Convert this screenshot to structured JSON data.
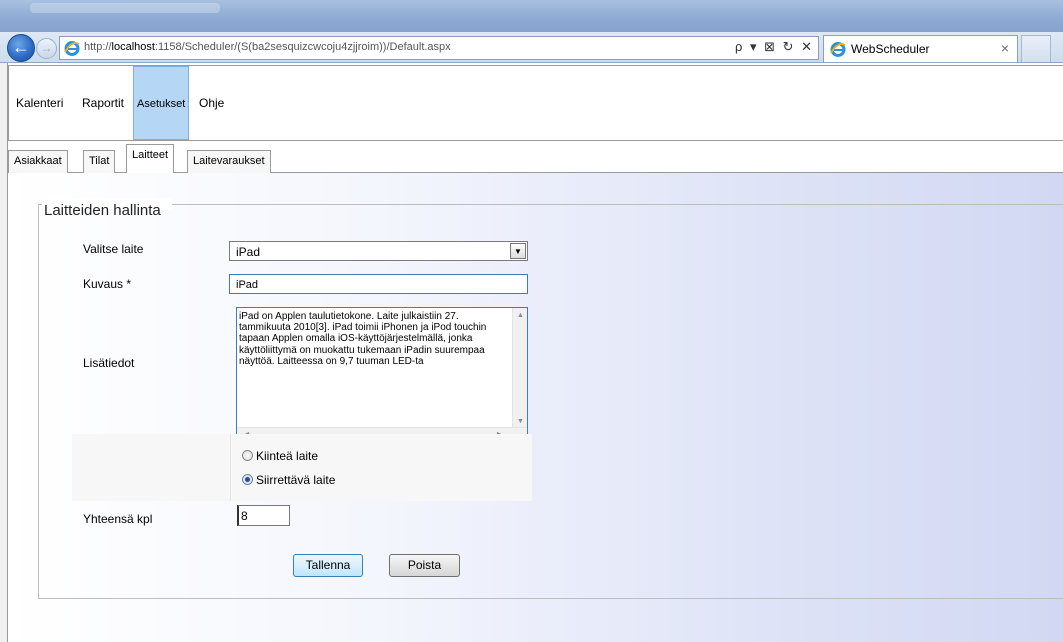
{
  "browser": {
    "url_prefix": "http://",
    "url_host": "localhost",
    "url_rest": ":1158/Scheduler/(S(ba2sesquizcwcoju4zjjroim))/Default.aspx",
    "address_tools": "ρ ▾ ⊠ ↻ ✕",
    "tab_title": "WebScheduler",
    "tab_close": "×"
  },
  "menu": {
    "items": [
      "Kalenteri",
      "Raportit",
      "Asetukset",
      "Ohje"
    ],
    "active": "Asetukset"
  },
  "tabs": {
    "items": [
      "Asiakkaat",
      "Tilat",
      "Laitteet",
      "Laitevaraukset"
    ],
    "active": "Laitteet"
  },
  "form": {
    "legend": "Laitteiden hallinta",
    "device_label": "Valitse laite",
    "device_value": "iPad",
    "description_label": "Kuvaus *",
    "description_value": "iPad",
    "info_label": "Lisätiedot",
    "info_value": "iPad on Applen taulutietokone. Laite julkaistiin 27. tammikuuta 2010[3]. iPad toimii iPhonen ja iPod touchin tapaan Applen omalla iOS-käyttöjärjestelmällä, jonka käyttöliittymä on muokattu tukemaan iPadin suurempaa näyttöä. Laitteessa on 9,7 tuuman LED-ta",
    "radio_fixed": "Kiinteä laite",
    "radio_mobile": "Siirrettävä laite",
    "radio_selected": "Siirrettävä laite",
    "count_label": "Yhteensä kpl",
    "count_value": "8",
    "save_button": "Tallenna",
    "delete_button": "Poista"
  }
}
